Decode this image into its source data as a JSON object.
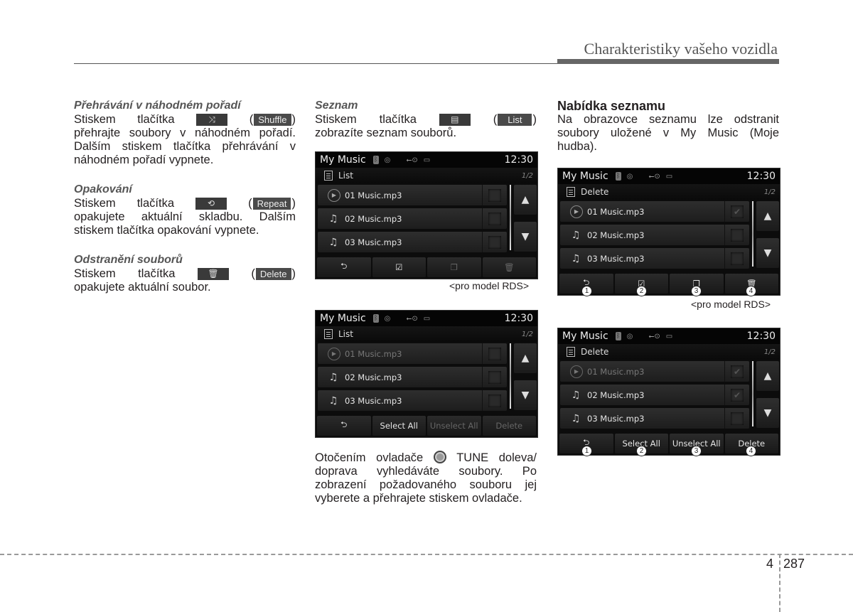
{
  "header": {
    "title": "Charakteristiky vašeho vozidla"
  },
  "col1": {
    "s1": {
      "heading": "Přehrávání v náhodném pořadí",
      "lead_left": "Stiskem",
      "lead_mid": "tlačítka",
      "btn_label": "Shuffle",
      "btn_icon": "shuffle-icon",
      "rest": "přehrajte soubory v náhodném pořadí. Dalším stiskem tlačítka přehrávání v náhodném pořadí vypnete."
    },
    "s2": {
      "heading": "Opakování",
      "lead_left": "Stiskem",
      "lead_mid": "tlačítka",
      "btn_label": "Repeat",
      "btn_icon": "repeat-icon",
      "rest": "opakujete aktuální skladbu. Dalším stiskem tlačítka opakování vypnete."
    },
    "s3": {
      "heading": "Odstranění souborů",
      "lead_left": "Stiskem",
      "lead_mid": "tlačítka",
      "btn_label": "Delete",
      "btn_icon": "trash-icon",
      "rest": "opakujete aktuální soubor."
    }
  },
  "col2": {
    "heading": "Seznam",
    "lead_left": "Stiskem",
    "lead_mid": "tlačítka",
    "btn_label": "List",
    "btn_icon": "list-icon",
    "rest": "zobrazíte seznam souborů.",
    "caption": "<pro model RDS>",
    "para": [
      "Otočením ovladače",
      "TUNE doleva/ doprava vyhledáváte soubory. Po zobrazení požadovaného souboru jej vyberete a přehrajete stiskem ovladače."
    ]
  },
  "col3": {
    "heading": "Nabídka seznamu",
    "para": "Na obrazovce seznamu lze odstranit soubory uložené v My Music (Moje hudba).",
    "caption": "<pro model RDS>"
  },
  "screens": [
    {
      "title": "My Music",
      "clock": "12:30",
      "sub": "List",
      "page": "1/2",
      "rows": [
        {
          "name": "01 Music.mp3",
          "icon": "play",
          "dim": false,
          "checked": false
        },
        {
          "name": "02 Music.mp3",
          "icon": "note",
          "dim": false,
          "checked": false
        },
        {
          "name": "03 Music.mp3",
          "icon": "note",
          "dim": false,
          "checked": false
        }
      ],
      "buttons": [
        {
          "label": "⮌",
          "icon": "back-icon"
        },
        {
          "label": "☑",
          "icon": "select-all-icon"
        },
        {
          "label": "❐",
          "icon": "unselect-all-icon",
          "dim": true
        },
        {
          "label": "🗑",
          "icon": "trash-icon",
          "dim": true
        }
      ]
    },
    {
      "title": "My Music",
      "clock": "12:30",
      "sub": "List",
      "page": "1/2",
      "rows": [
        {
          "name": "01 Music.mp3",
          "icon": "play",
          "dim": true,
          "checked": false
        },
        {
          "name": "02 Music.mp3",
          "icon": "note",
          "dim": false,
          "checked": false
        },
        {
          "name": "03 Music.mp3",
          "icon": "note",
          "dim": false,
          "checked": false
        }
      ],
      "buttons": [
        {
          "label": "⮌",
          "icon": "back-icon"
        },
        {
          "label": "Select All"
        },
        {
          "label": "Unselect All",
          "dim": true
        },
        {
          "label": "Delete",
          "dim": true
        }
      ]
    },
    {
      "title": "My Music",
      "clock": "12:30",
      "sub": "Delete",
      "page": "1/2",
      "rows": [
        {
          "name": "01 Music.mp3",
          "icon": "play",
          "dim": false,
          "checked": true
        },
        {
          "name": "02 Music.mp3",
          "icon": "note",
          "dim": false,
          "checked": false
        },
        {
          "name": "03 Music.mp3",
          "icon": "note",
          "dim": false,
          "checked": false
        }
      ],
      "buttons": [
        {
          "label": "⮌",
          "icon": "back-icon"
        },
        {
          "label": "☑",
          "icon": "select-all-icon"
        },
        {
          "label": "❐",
          "icon": "unselect-all-icon"
        },
        {
          "label": "🗑",
          "icon": "trash-icon"
        }
      ],
      "callouts": [
        "①",
        "②",
        "③",
        "④"
      ]
    },
    {
      "title": "My Music",
      "clock": "12:30",
      "sub": "Delete",
      "page": "1/2",
      "rows": [
        {
          "name": "01 Music.mp3",
          "icon": "play",
          "dim": true,
          "checked": true
        },
        {
          "name": "02 Music.mp3",
          "icon": "note",
          "dim": false,
          "checked": true
        },
        {
          "name": "03 Music.mp3",
          "icon": "note",
          "dim": false,
          "checked": false
        }
      ],
      "buttons": [
        {
          "label": "⮌",
          "icon": "back-icon"
        },
        {
          "label": "Select All"
        },
        {
          "label": "Unselect All"
        },
        {
          "label": "Delete"
        }
      ],
      "callouts": [
        "①",
        "②",
        "③",
        "④"
      ]
    }
  ],
  "footer": {
    "chapter": "4",
    "page": "287"
  }
}
